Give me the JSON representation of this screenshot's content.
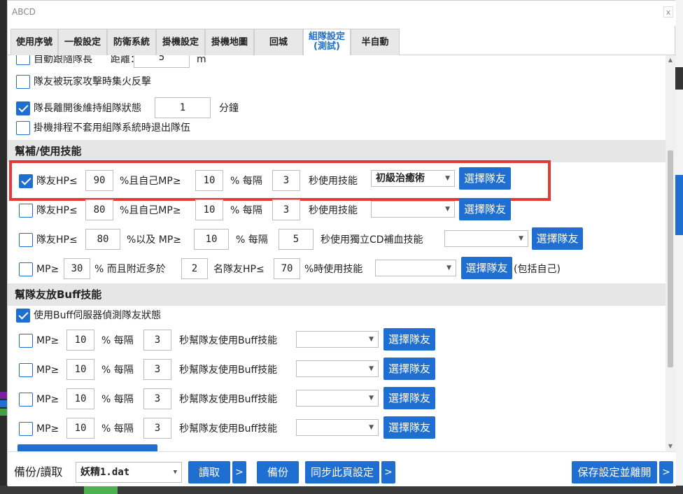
{
  "window": {
    "title": "ABCD",
    "close_glyph": "x"
  },
  "tabs": [
    {
      "label": "使用序號"
    },
    {
      "label": "一般設定"
    },
    {
      "label": "防衛系統"
    },
    {
      "label": "掛機設定"
    },
    {
      "label": "掛機地圖"
    },
    {
      "label": "回城"
    },
    {
      "label": "組隊設定\n(測試)"
    },
    {
      "label": "半自動"
    }
  ],
  "party": {
    "follow_leader": {
      "label": "自動跟隨隊長",
      "distance_label": "距離：",
      "distance_value": "5",
      "unit": "m",
      "checked": false
    },
    "focus_fire": {
      "label": "隊友被玩家攻擊時集火反擊",
      "checked": false
    },
    "keep_party": {
      "label": "隊長離開後維持組隊狀態",
      "value": "1",
      "unit": "分鐘",
      "checked": true
    },
    "exit_on_schedule": {
      "label": "掛機排程不套用組隊系統時退出隊伍",
      "checked": false
    }
  },
  "heal_section": {
    "title": "幫補/使用技能",
    "rows": [
      {
        "checked": true,
        "hp_label": "隊友HP≤",
        "hp": "90",
        "mp_label": "%且自己MP≥",
        "mp": "10",
        "every_label": "% 每隔",
        "secs": "3",
        "skill_label": "秒使用技能",
        "skill": "初級治癒術",
        "button": "選擇隊友"
      },
      {
        "checked": false,
        "hp_label": "隊友HP≤",
        "hp": "80",
        "mp_label": "%且自己MP≥",
        "mp": "10",
        "every_label": "% 每隔",
        "secs": "3",
        "skill_label": "秒使用技能",
        "skill": "",
        "button": "選擇隊友"
      }
    ],
    "cd_row": {
      "checked": false,
      "hp_label": "隊友HP≤",
      "hp": "80",
      "mp_label": "%以及 MP≥",
      "mp": "10",
      "every_label": "% 每隔",
      "secs": "5",
      "skill_label": "秒使用獨立CD補血技能",
      "skill": "",
      "button": "選擇隊友"
    },
    "mp_row": {
      "checked": false,
      "mp_label": "MP≥",
      "mp": "30",
      "near_label": "% 而且附近多於",
      "count": "2",
      "hp_label": "名隊友HP≤",
      "hp": "70",
      "skill_label": "%時使用技能",
      "skill": "",
      "button": "選擇隊友",
      "suffix": "(包括自己)"
    }
  },
  "buff_section": {
    "title": "幫隊友放Buff技能",
    "use_server": {
      "label": "使用Buff伺服器偵測隊友狀態",
      "checked": true
    },
    "rows": [
      {
        "checked": false,
        "mp_label": "MP≥",
        "mp": "10",
        "every_label": "% 每隔",
        "secs": "3",
        "skill_label": "秒幫隊友使用Buff技能",
        "skill": "",
        "button": "選擇隊友"
      },
      {
        "checked": false,
        "mp_label": "MP≥",
        "mp": "10",
        "every_label": "% 每隔",
        "secs": "3",
        "skill_label": "秒幫隊友使用Buff技能",
        "skill": "",
        "button": "選擇隊友"
      },
      {
        "checked": false,
        "mp_label": "MP≥",
        "mp": "10",
        "every_label": "% 每隔",
        "secs": "3",
        "skill_label": "秒幫隊友使用Buff技能",
        "skill": "",
        "button": "選擇隊友"
      },
      {
        "checked": false,
        "mp_label": "MP≥",
        "mp": "10",
        "every_label": "% 每隔",
        "secs": "3",
        "skill_label": "秒幫隊友使用Buff技能",
        "skill": "",
        "button": "選擇隊友"
      }
    ]
  },
  "bottom": {
    "backup_label": "備份/讀取",
    "file": "妖精1.dat",
    "read_button": "讀取",
    "more_glyph": ">",
    "backup_button": "備份",
    "sync_button": "同步此頁設定",
    "save_button": "保存設定並離開"
  },
  "colors": {
    "accent": "#1e6fd1",
    "highlight": "#e53935"
  }
}
